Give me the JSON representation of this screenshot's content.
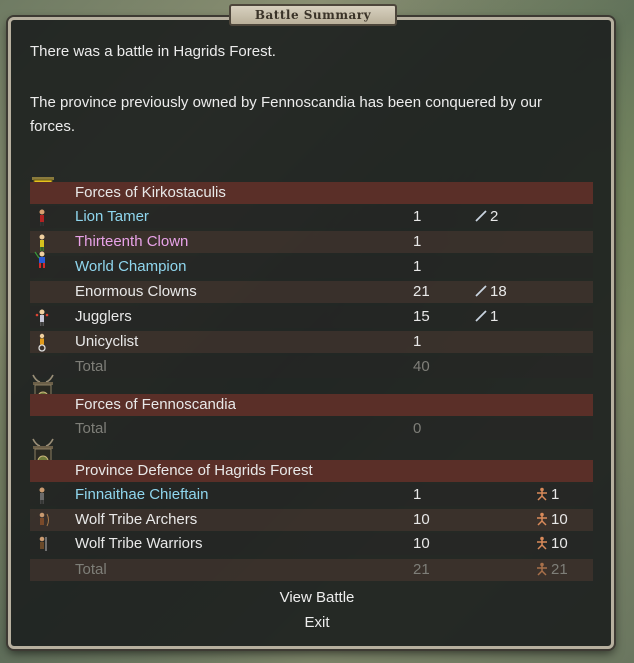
{
  "dialog": {
    "title": "Battle Summary",
    "message1": "There was a battle in Hagrids Forest.",
    "message2": "The province previously owned by Fennoscandia has been conquered by our forces."
  },
  "sides": [
    {
      "header": "Forces of Kirkostaculis",
      "banner": "yellow-banner",
      "units": [
        {
          "name": "Lion Tamer",
          "count": "1",
          "extra": "2",
          "type": "hero-blue"
        },
        {
          "name": "Thirteenth Clown",
          "count": "1",
          "extra": "",
          "type": "hero-pink"
        },
        {
          "name": "World Champion",
          "count": "1",
          "extra": "",
          "type": "hero-blue"
        },
        {
          "name": "Enormous Clowns",
          "count": "21",
          "extra": "18",
          "type": "normal"
        },
        {
          "name": "Jugglers",
          "count": "15",
          "extra": "1",
          "type": "normal"
        },
        {
          "name": "Unicyclist",
          "count": "1",
          "extra": "",
          "type": "normal"
        }
      ],
      "total_label": "Total",
      "total": "40"
    },
    {
      "header": "Forces of Fennoscandia",
      "banner": "antler-banner",
      "total_label": "Total",
      "total": "0"
    },
    {
      "header": "Province Defence of Hagrids Forest",
      "banner": "antler-banner",
      "units": [
        {
          "name": "Finnaithae Chieftain",
          "count": "1",
          "extra": "1",
          "type": "hero-blue"
        },
        {
          "name": "Wolf Tribe Archers",
          "count": "10",
          "extra": "10",
          "type": "normal"
        },
        {
          "name": "Wolf Tribe Warriors",
          "count": "10",
          "extra": "10",
          "type": "normal"
        }
      ],
      "total_label": "Total",
      "total": "21",
      "total_extra": "21"
    }
  ],
  "buttons": {
    "view_battle": "View Battle",
    "exit": "Exit"
  },
  "icons": {
    "kills": "sword-icon",
    "losses": "fallen-figure-icon"
  },
  "colors": {
    "header_row": "#5a2f28",
    "hero_blue": "#8fd6ee",
    "hero_pink": "#e8a2e8"
  }
}
